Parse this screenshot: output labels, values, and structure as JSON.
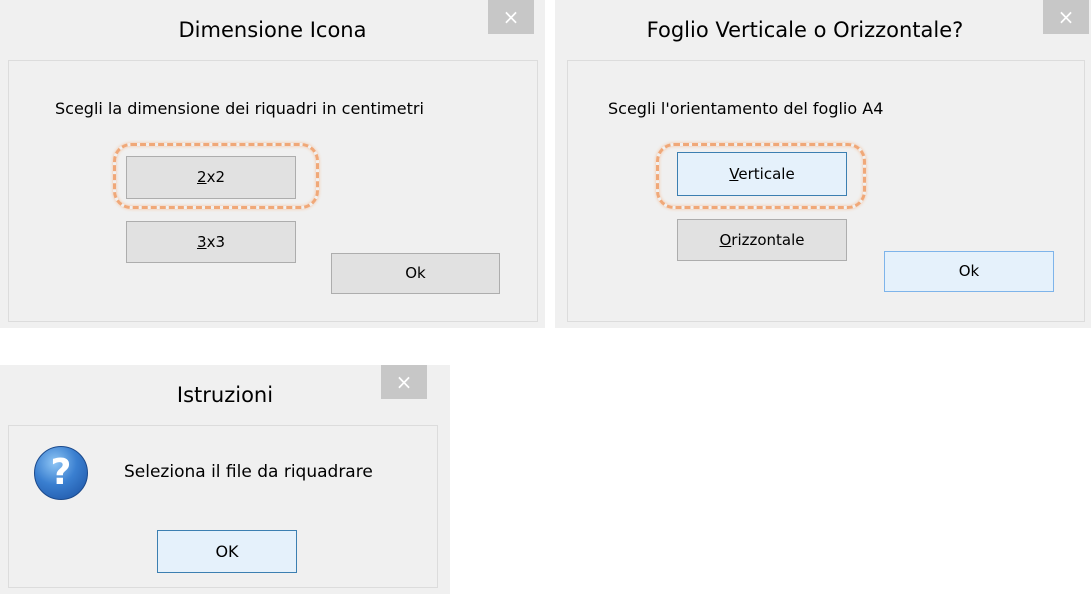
{
  "dialogs": {
    "dimensione": {
      "title": "Dimensione Icona",
      "close_glyph": "×",
      "prompt": "Scegli la dimensione dei riquadri in centimetri",
      "btn_2x2": {
        "mnemonic": "2",
        "rest": "x2"
      },
      "btn_3x3": {
        "mnemonic": "3",
        "rest": "x3"
      },
      "ok_label": "Ok"
    },
    "foglio": {
      "title": "Foglio Verticale o Orizzontale?",
      "close_glyph": "×",
      "prompt": "Scegli l'orientamento del foglio A4",
      "btn_verticale": {
        "mnemonic": "V",
        "rest": "erticale"
      },
      "btn_orizzontale": {
        "mnemonic": "O",
        "rest": "rizzontale"
      },
      "ok_label": "Ok"
    },
    "istruzioni": {
      "title": "Istruzioni",
      "close_glyph": "×",
      "icon": "question-icon",
      "icon_glyph": "?",
      "message": "Seleziona il file da riquadrare",
      "ok_label": "OK"
    }
  },
  "colors": {
    "highlight": "#f0a878",
    "close_button": "#c7c7c7",
    "focused_border": "#3c7fb1"
  }
}
